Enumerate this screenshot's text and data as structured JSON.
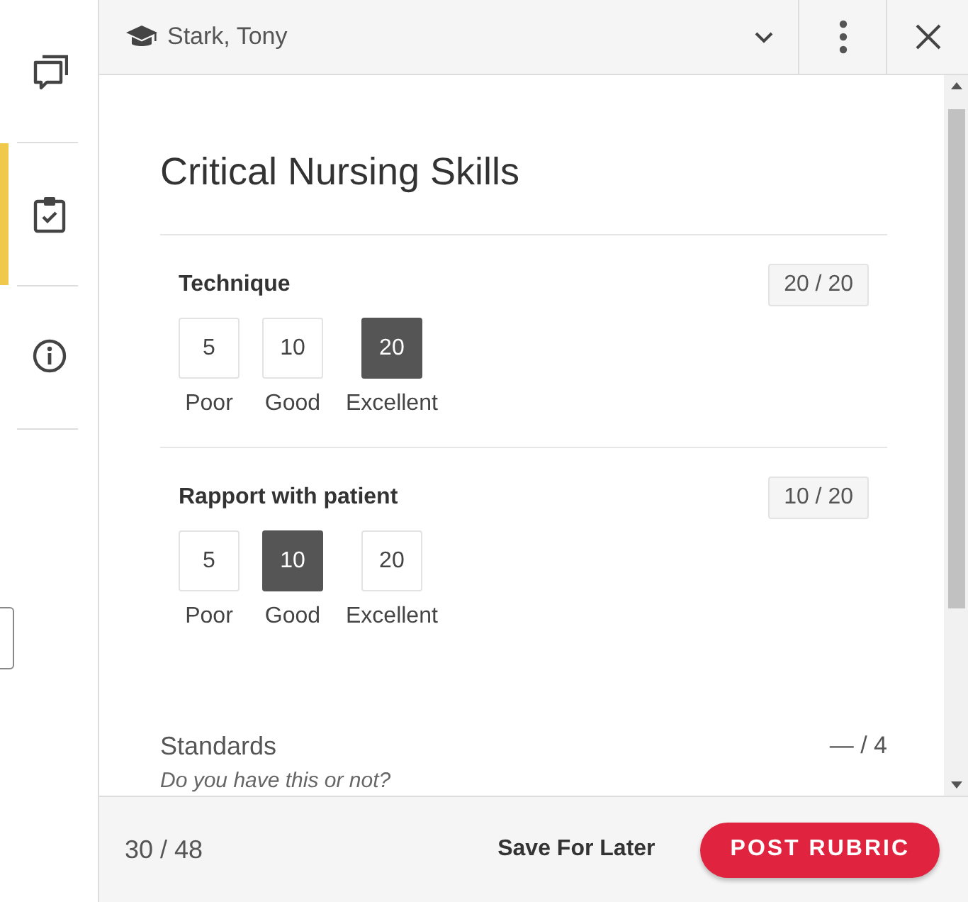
{
  "student": {
    "name": "Stark, Tony"
  },
  "sidebar": {
    "items": [
      {
        "kind": "comments",
        "selected": false
      },
      {
        "kind": "rubric",
        "selected": true
      },
      {
        "kind": "info",
        "selected": false
      }
    ]
  },
  "rubric": {
    "title": "Critical Nursing Skills",
    "criteria": [
      {
        "name": "Technique",
        "score": "20 / 20",
        "ratings": [
          {
            "points": "5",
            "label": "Poor",
            "selected": false
          },
          {
            "points": "10",
            "label": "Good",
            "selected": false
          },
          {
            "points": "20",
            "label": "Excellent",
            "selected": true
          }
        ]
      },
      {
        "name": "Rapport with patient",
        "score": "10 / 20",
        "ratings": [
          {
            "points": "5",
            "label": "Poor",
            "selected": false
          },
          {
            "points": "10",
            "label": "Good",
            "selected": true
          },
          {
            "points": "20",
            "label": "Excellent",
            "selected": false
          }
        ]
      }
    ],
    "standards": {
      "name": "Standards",
      "score": "— / 4",
      "description": "Do you have this or not?"
    }
  },
  "footer": {
    "total": "30 / 48",
    "save": "Save For Later",
    "post": "POST RUBRIC"
  }
}
